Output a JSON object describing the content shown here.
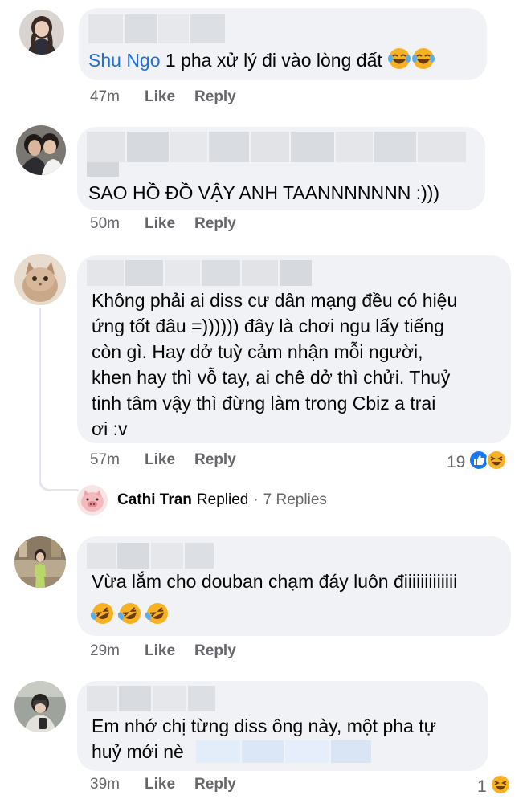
{
  "comments": [
    {
      "author_link": "Shu Ngo",
      "text": "1 pha xử lý đi vào lòng đất",
      "time": "47m",
      "like": "Like",
      "reply": "Reply"
    },
    {
      "text": "SAO HỒ ĐỒ VẬY ANH TAANNNNNNN :)))",
      "time": "50m",
      "like": "Like",
      "reply": "Reply"
    },
    {
      "lines": [
        "Không phải ai diss cư dân mạng đều có hiệu",
        "ứng tốt đâu =)))))) đây là chơi ngu lấy tiếng",
        "còn gì. Hay dở tuỳ cảm nhận mỗi người,",
        "khen hay thì vỗ tay, ai chê dở thì chửi. Thuỷ",
        "tinh tâm vậy thì đừng làm trong Cbiz a trai",
        "ơi :v"
      ],
      "time": "57m",
      "like": "Like",
      "reply": "Reply",
      "reaction_count": "19",
      "replied": {
        "name": "Cathi Tran",
        "label": "Replied",
        "dot": "·",
        "count": "7 Replies"
      }
    },
    {
      "text": "Vừa lắm cho douban chạm đáy luôn điiiiiiiiiiiii",
      "time": "29m",
      "like": "Like",
      "reply": "Reply"
    },
    {
      "lines": [
        "Em nhớ chị từng diss ông này, một pha tự",
        "huỷ mới nè"
      ],
      "time": "39m",
      "like": "Like",
      "reply": "Reply",
      "reaction_count": "1"
    }
  ],
  "colors": {
    "bubble": "#f0f2f5",
    "link": "#216fdb",
    "meta": "#65676b",
    "like_blue": "#1877f2",
    "haha_yellow": "#f7b125"
  },
  "icons": [
    "laughing-tears-emoji",
    "rolling-laugh-emoji",
    "like-reaction-icon",
    "haha-reaction-icon"
  ]
}
